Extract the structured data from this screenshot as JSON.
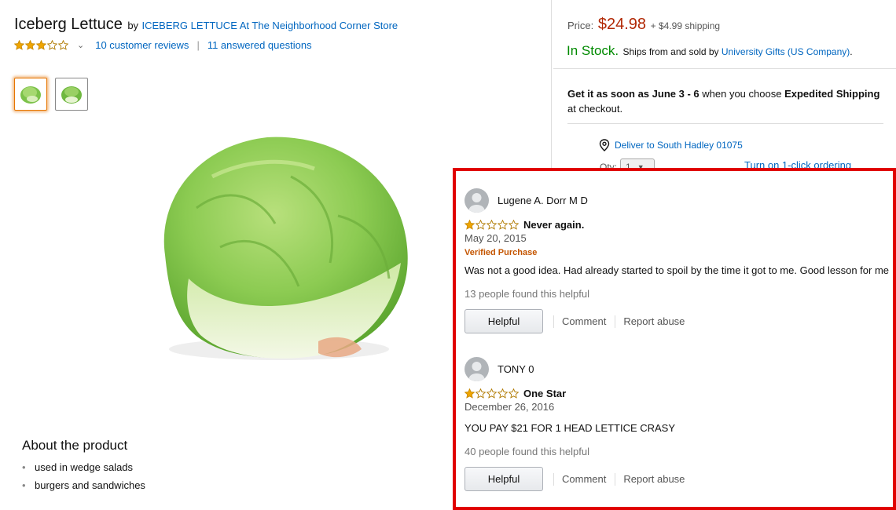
{
  "product": {
    "title": "Iceberg Lettuce",
    "by_label": "by",
    "brand": "ICEBERG LETTUCE At The Neighborhood Corner Store",
    "rating": 3,
    "rating_max": 5,
    "reviews_link": "10 customer reviews",
    "separator": "|",
    "questions_link": "11 answered questions",
    "thumbnails": [
      "lettuce-thumb-1",
      "lettuce-thumb-2"
    ],
    "selected_thumbnail": 0
  },
  "about": {
    "heading": "About the product",
    "bullets": [
      "used in wedge salads",
      "burgers and sandwiches"
    ]
  },
  "buybox": {
    "price_label": "Price:",
    "price": "$24.98",
    "shipping": "+ $4.99 shipping",
    "in_stock": "In Stock.",
    "ships_from": "Ships from and sold by",
    "seller": "University Gifts (US Company)",
    "seller_suffix": ".",
    "delivery_prefix": "Get it as soon as",
    "delivery_dates": "June 3 - 6",
    "delivery_mid": "when you choose",
    "delivery_method": "Expedited Shipping",
    "delivery_suffix": "at checkout.",
    "deliver_to": "Deliver to South Hadley 01075",
    "qty_label": "Qty:",
    "qty_value": "1",
    "one_click": "Turn on 1-click ordering"
  },
  "reviews": [
    {
      "name": "Lugene A. Dorr M D",
      "rating": 1,
      "title": "Never again.",
      "date": "May 20, 2015",
      "verified": "Verified Purchase",
      "body": "Was not a good idea. Had already started to spoil by the time it got to me. Good lesson for me",
      "helpful_count": "13 people found this helpful",
      "helpful_btn": "Helpful",
      "comment": "Comment",
      "report": "Report abuse"
    },
    {
      "name": "TONY 0",
      "rating": 1,
      "title": "One Star",
      "date": "December 26, 2016",
      "body": "YOU PAY $21 FOR 1 HEAD LETTICE CRASY",
      "helpful_count": "40 people found this helpful",
      "helpful_btn": "Helpful",
      "comment": "Comment",
      "report": "Report abuse"
    }
  ],
  "colors": {
    "price": "#b12704",
    "in_stock": "#008a00",
    "link": "#0066c0",
    "verified": "#c45500",
    "highlight_border": "#e00000",
    "star_fill": "#f0a500"
  }
}
